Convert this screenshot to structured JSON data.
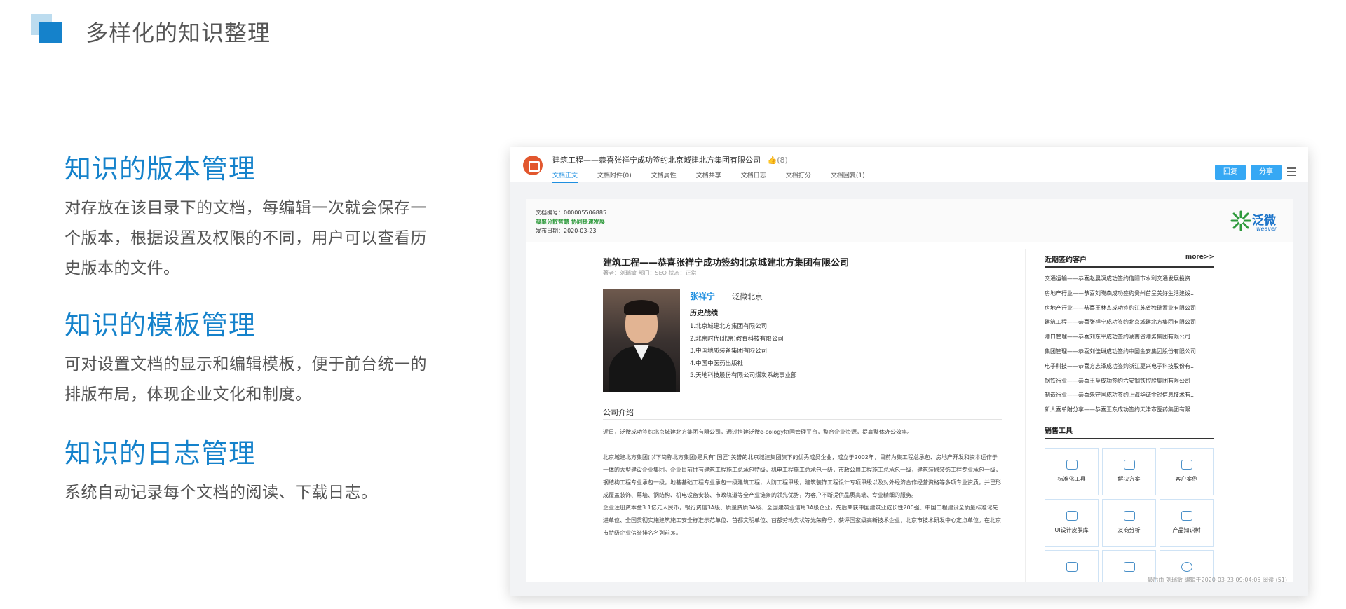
{
  "slide": {
    "title": "多样化的知识整理",
    "features": [
      {
        "heading": "知识的版本管理",
        "body": "对存放在该目录下的文档，每编辑一次就会保存一个版本，根据设置及权限的不同，用户可以查看历史版本的文件。"
      },
      {
        "heading": "知识的模板管理",
        "body": "可对设置文档的显示和编辑模板，便于前台统一的排版布局，体现企业文化和制度。"
      },
      {
        "heading": "知识的日志管理",
        "body": "系统自动记录每个文档的阅读、下载日志。"
      }
    ]
  },
  "screenshot": {
    "doc_title": "建筑工程——恭喜张祥宁成功签约北京城建北方集团有限公司",
    "likes": "(8)",
    "tabs": [
      "文档正文",
      "文档附件(0)",
      "文档属性",
      "文档共享",
      "文档日志",
      "文档打分",
      "文档回复(1)"
    ],
    "reply_button": "回复",
    "share_button": "分享",
    "doc_number": "文档编号：000005506885",
    "slogan": "凝聚分散智慧 协同提速发展",
    "publish_date": "发布日期：2020-03-23",
    "brand_cn": "泛微",
    "brand_en": "weaver",
    "article": {
      "title": "建筑工程——恭喜张祥宁成功签约北京城建北方集团有限公司",
      "meta": "著者：刘瑞敏     部门：SEO     状态：正常",
      "person_name": "张祥宁",
      "person_company": "泛微北京",
      "history_heading": "历史战绩",
      "history": [
        "1.北京城建北方集团有限公司",
        "2.北京时代(北京)教育科技有限公司",
        "3.中国地质装备集团有限公司",
        "4.中国中医药出版社",
        "5.天地科技股份有限公司煤炭系统事业部"
      ],
      "intro_heading": "公司介绍",
      "paragraphs": [
        "近日，泛微成功签约北京城建北方集团有限公司，通过搭建泛微e-cology协同管理平台，整合企业资源，提高整体办公效率。",
        "北京城建北方集团(以下简称北方集团)是具有“国匠”美誉的北京城建集团旗下的优秀成员企业，成立于2002年，目前为集工程总承包、房地产开发和资本运作于一体的大型建设企业集团。企业目前拥有建筑工程施工总承包特级，机电工程施工总承包一级，市政公用工程施工总承包一级，建筑装修装饰工程专业承包一级，钢结构工程专业承包一级，地基基础工程专业承包一级建筑工程，人防工程甲级，建筑装饰工程设计专项甲级以及对外经济合作经营资格等多项专业资质，并已形成覆盖装饰、幕墙、钢结构、机电设备安装、市政轨道等全产业链条的领先优势，为客户不断提供品质高端、专业精细的服务。",
        "企业注册资本金3.1亿元人民币，银行资信3A级、质量资质3A级、全国建筑业信用3A级企业，先后荣获中国建筑业成长性200强、中国工程建设全质量标准化先进单位、全国贯彻实施建筑施工安全标准示范单位、首都文明单位、首都劳动奖状等光荣称号，获评国家级高新技术企业，北京市技术研发中心定点单位。在北京市特级企业信誉排名名列前茅。"
      ]
    },
    "sidebar": {
      "clients_heading": "近期签约客户",
      "more": "more>>",
      "clients": [
        "交通运输——恭喜赵晨溟成功签约信阳市水利交通发展投资...",
        "房地产行业——恭喜刘晓森成功签约贵州首呈美好生活建设...",
        "房地产行业——恭喜王林杰成功签约江苏省独瑞置业有限公司",
        "建筑工程——恭喜张祥宁成功签约北京城建北方集团有限公司",
        "港口管理——恭喜刘东平成功签约湖南省港务集团有限公司",
        "集团管理——恭喜刘佳琳成功签约中国金安集团股份有限公司",
        "电子科技——恭喜方志泽成功签约浙江夏兴电子科技股份有...",
        "钢铁行业——恭喜王至成功签约六安钢铁控股集团有限公司",
        "制造行业——恭喜朱守国成功签约上海华诚金锐信息技术有...",
        "新人喜单附分享——恭喜王东成功签约天津市医药集团有限..."
      ],
      "tools_heading": "销售工具",
      "tools": [
        {
          "label": "标准化工具",
          "icon": "gear-icon"
        },
        {
          "label": "解决方案",
          "icon": "building-icon"
        },
        {
          "label": "客户案例",
          "icon": "user-icon"
        },
        {
          "label": "UI设计皮肤库",
          "icon": "layout-icon"
        },
        {
          "label": "友商分析",
          "icon": "book-icon"
        },
        {
          "label": "产品知识树",
          "icon": "library-icon"
        },
        {
          "label": "",
          "icon": "profile-icon"
        },
        {
          "label": "",
          "icon": "document-icon"
        },
        {
          "label": "",
          "icon": "play-icon"
        }
      ]
    },
    "footer": "最后由  刘瑞敏  编辑于2020-03-23 09:04:05  阅读 (51)"
  }
}
